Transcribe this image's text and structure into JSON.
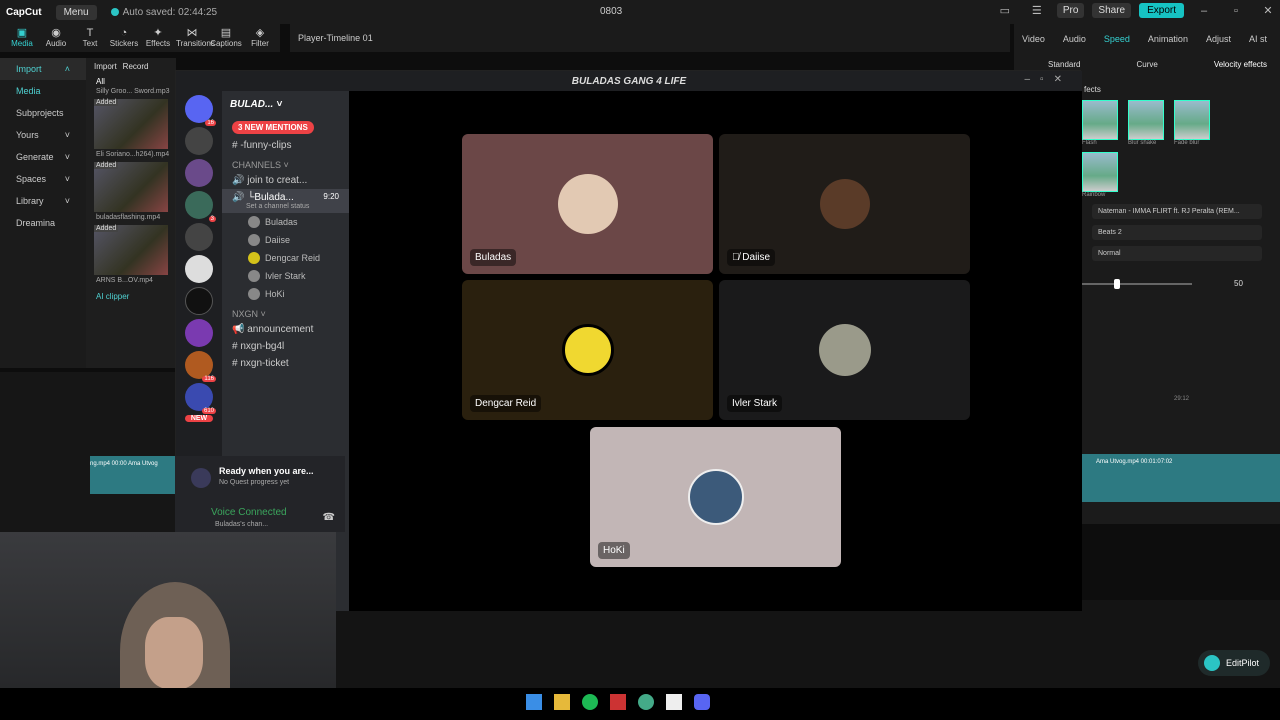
{
  "capcut": {
    "logo": "CapCut",
    "menu": "Menu",
    "autosave": "Auto saved: 02:44:25",
    "project_title": "0803",
    "pro": "Pro",
    "share": "Share",
    "export": "Export",
    "tool_tabs": [
      "Media",
      "Audio",
      "Text",
      "Stickers",
      "Effects",
      "Transitions",
      "Captions",
      "Filter"
    ],
    "left_nav": [
      "Import",
      "Media",
      "Subprojects",
      "Yours",
      "Generate",
      "Spaces",
      "Library",
      "Dreamina"
    ],
    "media_toolbar": [
      "Import",
      "Record"
    ],
    "media_filter": "All",
    "media_items": [
      {
        "tag": "Added",
        "caption": "Eli Soriano...h264).mp4",
        "time": "02:05"
      },
      {
        "tag": "Added",
        "caption": "buladasflashing.mp4",
        "time": "00:27"
      },
      {
        "tag": "Added",
        "caption": "ARNS B...OV.mp4",
        "time": "02:20:32"
      }
    ],
    "media_top_caption": "Silly Groo... Sword.mp3",
    "ai_clipper": "AI clipper",
    "player_title": "Player-Timeline 01",
    "right_tabs": [
      "Video",
      "Audio",
      "Speed",
      "Animation",
      "Adjust",
      "AI st"
    ],
    "speed_subtabs": [
      "Standard",
      "Curve",
      "Velocity effects"
    ],
    "effects_label": "fects",
    "effects": [
      "Flash",
      "Blur shake",
      "Fade blur",
      "Rainbow"
    ],
    "dropdowns": [
      "Nateman - IMMA FLIRT ft. RJ Peralta (REM...",
      "Beats 2",
      "Normal"
    ],
    "slider_value": "50",
    "timeline_clip_1": "ng.mp4  00:00  Ama Utvog",
    "timeline_clip_2": "Ama Utvog.mp4  00:01:07:02",
    "timeline_time": "29:12",
    "editpilot": "EditPilot"
  },
  "discord": {
    "window_title": "BULADAS GANG 4 LIFE",
    "server_name": "BULAD...",
    "mentions": "3 NEW MENTIONS",
    "channels": [
      {
        "name": "-funny-clips",
        "type": "text"
      },
      {
        "name": "CHANNELS",
        "type": "category"
      },
      {
        "name": "join to creat...",
        "type": "voice"
      },
      {
        "name": "└Bulada...",
        "type": "voice-active",
        "time": "9:20",
        "status": "Set a channel status"
      }
    ],
    "voice_members": [
      "Buladas",
      "Daiise",
      "Dengcar Reid",
      "Ivler Stark",
      "HoKi"
    ],
    "category_2": "NXGN",
    "channels_2": [
      "announcement",
      "nxgn-bg4l",
      "nxgn-ticket"
    ],
    "server_badges": [
      "16",
      "3",
      "116",
      "610"
    ],
    "new_label": "NEW",
    "quest_title": "Ready when you are...",
    "quest_sub": "No Quest progress yet",
    "voice_connected": "Voice Connected",
    "voice_channel": "Buladas's chan...",
    "tiles": [
      {
        "name": "Buladas",
        "bg": "#6b4747",
        "muted": false
      },
      {
        "name": "Daiise",
        "bg": "#201c18",
        "muted": true
      },
      {
        "name": "Dengcar Reid",
        "bg": "#2a200e",
        "muted": false
      },
      {
        "name": "Ivler Stark",
        "bg": "#1a1a1b",
        "muted": false
      },
      {
        "name": "HoKi",
        "bg": "#c2b6b6",
        "muted": false
      }
    ]
  }
}
